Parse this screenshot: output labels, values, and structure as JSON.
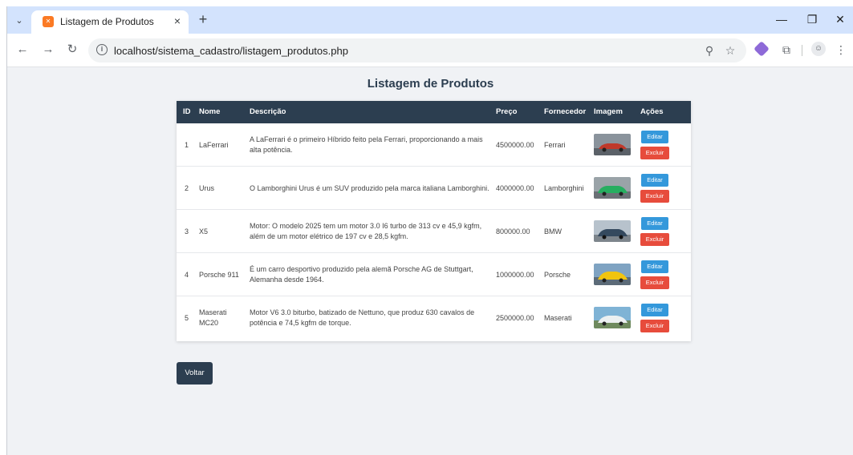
{
  "browser": {
    "tab_title": "Listagem de Produtos",
    "url": "localhost/sistema_cadastro/listagem_produtos.php"
  },
  "page": {
    "title": "Listagem de Produtos",
    "headers": {
      "id": "ID",
      "nome": "Nome",
      "descricao": "Descrição",
      "preco": "Preço",
      "fornecedor": "Fornecedor",
      "imagem": "Imagem",
      "acoes": "Ações"
    },
    "rows": [
      {
        "id": "1",
        "nome": "LaFerrari",
        "descricao": "A LaFerrari é o primeiro Híbrido feito pela Ferrari, proporcionando a mais alta potência.",
        "preco": "4500000.00",
        "fornecedor": "Ferrari",
        "car_color": "#c0392b",
        "edit_label": "Editar",
        "delete_label": "Excluir"
      },
      {
        "id": "2",
        "nome": "Urus",
        "descricao": "O Lamborghini Urus é um SUV produzido pela marca italiana Lamborghini.",
        "preco": "4000000.00",
        "fornecedor": "Lamborghini",
        "car_color": "#27ae60",
        "edit_label": "Editar",
        "delete_label": "Excluir"
      },
      {
        "id": "3",
        "nome": "X5",
        "descricao": "Motor: O modelo 2025 tem um motor 3.0 I6 turbo de 313 cv e 45,9 kgfm, além de um motor elétrico de 197 cv e 28,5 kgfm.",
        "preco": "800000.00",
        "fornecedor": "BMW",
        "car_color": "#34495e",
        "edit_label": "Editar",
        "delete_label": "Excluir"
      },
      {
        "id": "4",
        "nome": "Porsche 911",
        "descricao": "É um carro desportivo produzido pela alemã Porsche AG de Stuttgart, Alemanha desde 1964.",
        "preco": "1000000.00",
        "fornecedor": "Porsche",
        "car_color": "#f1c40f",
        "edit_label": "Editar",
        "delete_label": "Excluir"
      },
      {
        "id": "5",
        "nome": "Maserati MC20",
        "descricao": "Motor V6 3.0 biturbo, batizado de Nettuno, que produz 630 cavalos de potência e 74,5 kgfm de torque.",
        "preco": "2500000.00",
        "fornecedor": "Maserati",
        "car_color": "#ecf0f1",
        "edit_label": "Editar",
        "delete_label": "Excluir"
      }
    ],
    "back_label": "Voltar"
  },
  "colors": {
    "header_bg": "#2c3e50",
    "edit_button": "#3498db",
    "delete_button": "#e74c3c",
    "page_bg": "#f0f2f5"
  },
  "icons": {
    "tab_menu": "chevron-down-icon",
    "favicon": "xampp-favicon",
    "back": "arrow-left-icon",
    "forward": "arrow-right-icon",
    "reload": "reload-icon",
    "info": "info-icon",
    "zoom": "zoom-icon",
    "bookmark": "star-icon",
    "extension": "extension-icon",
    "puzzle": "puzzle-icon",
    "profile": "profile-icon",
    "menu": "kebab-menu-icon"
  }
}
